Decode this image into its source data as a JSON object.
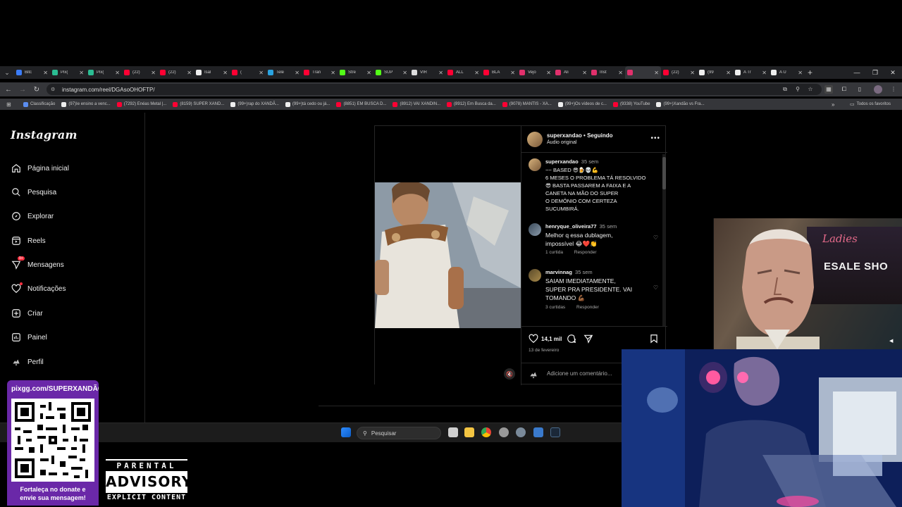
{
  "browser": {
    "tabs": [
      {
        "label": "Bitc",
        "color": "#3b7cf7"
      },
      {
        "label": "Pix(",
        "color": "#2bbd93"
      },
      {
        "label": "Pix(",
        "color": "#2bbd93"
      },
      {
        "label": "(22)",
        "color": "#ff0033"
      },
      {
        "label": "(22)",
        "color": "#ff0033"
      },
      {
        "label": "Isal",
        "color": "#eeeeee"
      },
      {
        "label": "(",
        "color": "#ff0033"
      },
      {
        "label": "Tele",
        "color": "#2aa3e0"
      },
      {
        "label": "Tran",
        "color": "#ff0033"
      },
      {
        "label": "Stre",
        "color": "#53fc18"
      },
      {
        "label": "SUP",
        "color": "#53fc18"
      },
      {
        "label": "VIR",
        "color": "#dddddd"
      },
      {
        "label": "ALL",
        "color": "#ff0033"
      },
      {
        "label": "BLA",
        "color": "#ff0033"
      },
      {
        "label": "Vejo",
        "color": "#e1306c"
      },
      {
        "label": "Ali",
        "color": "#e1306c"
      },
      {
        "label": "Inst",
        "color": "#e1306c"
      },
      {
        "label": "",
        "color": "#e1306c",
        "active": true
      },
      {
        "label": "(22)",
        "color": "#ff0033"
      },
      {
        "label": "(99",
        "color": "#eeeeee"
      },
      {
        "label": "A Tr",
        "color": "#eeeeee"
      },
      {
        "label": "A Ú",
        "color": "#eeeeee"
      }
    ],
    "url": "instagram.com/reel/DGAsoOHOFTP/",
    "bookmarks": [
      {
        "label": "Classificação",
        "color": "#5b8def"
      },
      {
        "label": "(97)Ie ensino a venc...",
        "color": "#eeeeee"
      },
      {
        "label": "(7292) Enéas Metal |...",
        "color": "#ff0033"
      },
      {
        "label": "(8159) SUPER XAND...",
        "color": "#ff0033"
      },
      {
        "label": "(99+)rap do XANDÃ...",
        "color": "#eeeeee"
      },
      {
        "label": "(99+)tá cedo ou já...",
        "color": "#eeeeee"
      },
      {
        "label": "(8851) EM BUSCA D...",
        "color": "#ff0033"
      },
      {
        "label": "(8912) VAI XANDIN...",
        "color": "#ff0033"
      },
      {
        "label": "(8912) Em Busca da...",
        "color": "#ff0033"
      },
      {
        "label": "(9078) MANTIS - XA...",
        "color": "#ff0033"
      },
      {
        "label": "(99+)Os vídeos de c...",
        "color": "#eeeeee"
      },
      {
        "label": "(9338) YouTube",
        "color": "#ff0033"
      },
      {
        "label": "(99+)Xandão vs Fra...",
        "color": "#eeeeee"
      }
    ],
    "all_favorites": "Todos os favoritos"
  },
  "instagram": {
    "logo": "Instagram",
    "nav": [
      {
        "label": "Página inicial",
        "icon": "home-icon"
      },
      {
        "label": "Pesquisa",
        "icon": "search-icon"
      },
      {
        "label": "Explorar",
        "icon": "compass-icon"
      },
      {
        "label": "Reels",
        "icon": "reels-icon"
      },
      {
        "label": "Mensagens",
        "icon": "messenger-icon",
        "badge": "9+"
      },
      {
        "label": "Notificações",
        "icon": "heart-icon"
      },
      {
        "label": "Criar",
        "icon": "plus-square-icon"
      },
      {
        "label": "Painel",
        "icon": "chart-icon"
      },
      {
        "label": "Perfil",
        "icon": "profile-avatar"
      }
    ],
    "post": {
      "author": "superxandao",
      "separator": "•",
      "follow_state": "Seguindo",
      "audio": "Áudio original",
      "caption": {
        "user": "superxandao",
        "time": "35 sem",
        "text": "~~ BASED 😎🍺💀💪\n6 MESES O PROBLEMA TÁ RESOLVIDO\n😎 BASTA PASSAREM A FAIXA E A\nCANETA NA MÃO DO SUPER\nO DEMÔNIO COM CERTEZA\nSUCUMBIRÁ."
      },
      "comments": [
        {
          "user": "henryque_oliveira77",
          "time": "35 sem",
          "text": "Melhor q essa dublagem,\nimpossível 😂❤️👏",
          "likes": "1 curtida",
          "reply": "Responder"
        },
        {
          "user": "marvinnag",
          "time": "35 sem",
          "text": "SAIAM IMEDIATAMENTE,\nSUPER PRA PRESIDENTE. VAI\nTOMANDO 💪🏾",
          "likes": "3 curtidas",
          "reply": "Responder"
        }
      ],
      "like_count": "14,1 mil",
      "date": "13 de fevereiro",
      "add_comment_placeholder": "Adicione um comentário..."
    }
  },
  "taskbar": {
    "search_placeholder": "Pesquisar"
  },
  "overlays": {
    "meme_sign_1": "Ladies",
    "meme_sign_2": "ESALE SHO",
    "qr_url": "pixgg.com/SUPERXANDÃO",
    "qr_line1": "Fortaleça no donate e",
    "qr_line2": "envie sua mensagem!",
    "advisory_top": "PARENTAL",
    "advisory_mid": "ADVISORY",
    "advisory_bottom": "EXPLICIT CONTENT"
  }
}
